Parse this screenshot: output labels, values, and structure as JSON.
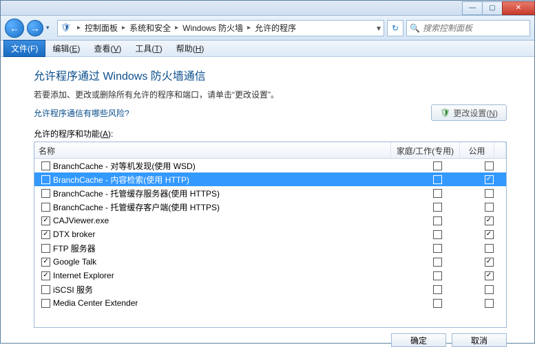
{
  "title_bar": {
    "blur_text": ""
  },
  "win_buttons": {
    "min": "—",
    "max": "▢",
    "close": "✕"
  },
  "nav": {
    "back_glyph": "←",
    "fwd_glyph": "→",
    "breadcrumb": {
      "icon": "🛡",
      "sep": "▸",
      "segs": [
        "控制面板",
        "系统和安全",
        "Windows 防火墙",
        "允许的程序"
      ],
      "drop": "▾"
    },
    "refresh": "↻",
    "search_placeholder": "搜索控制面板",
    "search_icon": "🔍"
  },
  "menu": {
    "file": "文件(F)",
    "items": [
      {
        "pre": "编辑(",
        "hot": "E",
        "post": ")"
      },
      {
        "pre": "查看(",
        "hot": "V",
        "post": ")"
      },
      {
        "pre": "工具(",
        "hot": "T",
        "post": ")"
      },
      {
        "pre": "帮助(",
        "hot": "H",
        "post": ")"
      }
    ]
  },
  "content": {
    "heading": "允许程序通过 Windows 防火墙通信",
    "sub": "若要添加、更改或删除所有允许的程序和端口，请单击“更改设置”。",
    "risk_link": "允许程序通信有哪些风险?",
    "change_btn": {
      "shield": "🛡",
      "pre": "更改设置(",
      "hot": "N",
      "post": ")"
    },
    "list_label": {
      "pre": "允许的程序和功能(",
      "hot": "A",
      "post": "):"
    }
  },
  "table": {
    "headers": {
      "name": "名称",
      "home": "家庭/工作(专用)",
      "pub": "公用"
    },
    "rows": [
      {
        "enabled": false,
        "name": "BranchCache - 对等机发现(使用 WSD)",
        "home": false,
        "pub": false,
        "selected": false
      },
      {
        "enabled": false,
        "name": "BranchCache - 内容检索(使用 HTTP)",
        "home": false,
        "pub": true,
        "selected": true
      },
      {
        "enabled": false,
        "name": "BranchCache - 托管缓存服务器(使用 HTTPS)",
        "home": false,
        "pub": false,
        "selected": false
      },
      {
        "enabled": false,
        "name": "BranchCache - 托管缓存客户端(使用 HTTPS)",
        "home": false,
        "pub": false,
        "selected": false
      },
      {
        "enabled": true,
        "name": "CAJViewer.exe",
        "home": false,
        "pub": true,
        "selected": false
      },
      {
        "enabled": true,
        "name": "DTX broker",
        "home": false,
        "pub": true,
        "selected": false
      },
      {
        "enabled": false,
        "name": "FTP 服务器",
        "home": false,
        "pub": false,
        "selected": false
      },
      {
        "enabled": true,
        "name": "Google Talk",
        "home": false,
        "pub": true,
        "selected": false
      },
      {
        "enabled": true,
        "name": "Internet Explorer",
        "home": false,
        "pub": true,
        "selected": false
      },
      {
        "enabled": false,
        "name": "iSCSI 服务",
        "home": false,
        "pub": false,
        "selected": false
      },
      {
        "enabled": false,
        "name": "Media Center Extender",
        "home": false,
        "pub": false,
        "selected": false
      }
    ]
  },
  "bottom": {
    "ok": "确定",
    "cancel": "取消"
  }
}
